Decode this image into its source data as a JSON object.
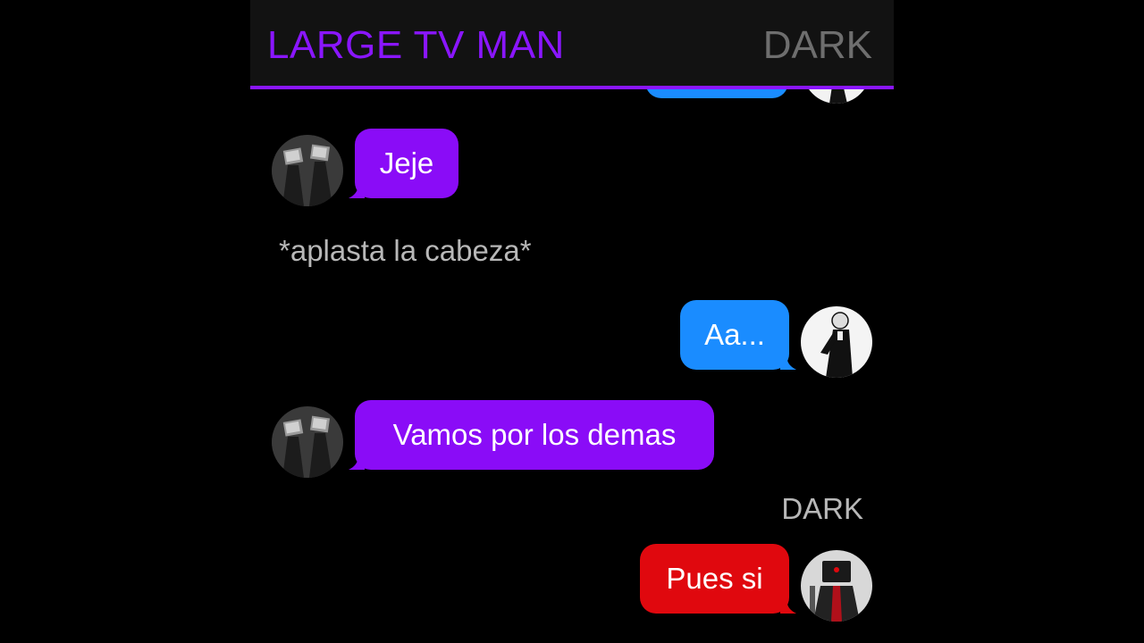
{
  "header": {
    "title": "LARGE TV MAN",
    "right_label": "DARK"
  },
  "messages": [
    {
      "side": "left",
      "color": "purple",
      "text": "Jeje",
      "avatar": "tv-man-avatar"
    },
    {
      "kind": "narration",
      "text": "*aplasta la cabeza*"
    },
    {
      "side": "right",
      "color": "blue",
      "text": "Aa...",
      "avatar": "white-figure-avatar"
    },
    {
      "side": "left",
      "color": "purple",
      "text": "Vamos por los demas",
      "avatar": "tv-man-avatar"
    },
    {
      "kind": "sender-name",
      "text": "DARK"
    },
    {
      "side": "right",
      "color": "red",
      "text": "Pues si",
      "avatar": "red-tv-man-avatar"
    }
  ],
  "colors": {
    "accent_purple": "#8a0cf7",
    "blue_bubble": "#1a8cff",
    "red_bubble": "#e0080e",
    "header_bg": "#121212"
  }
}
